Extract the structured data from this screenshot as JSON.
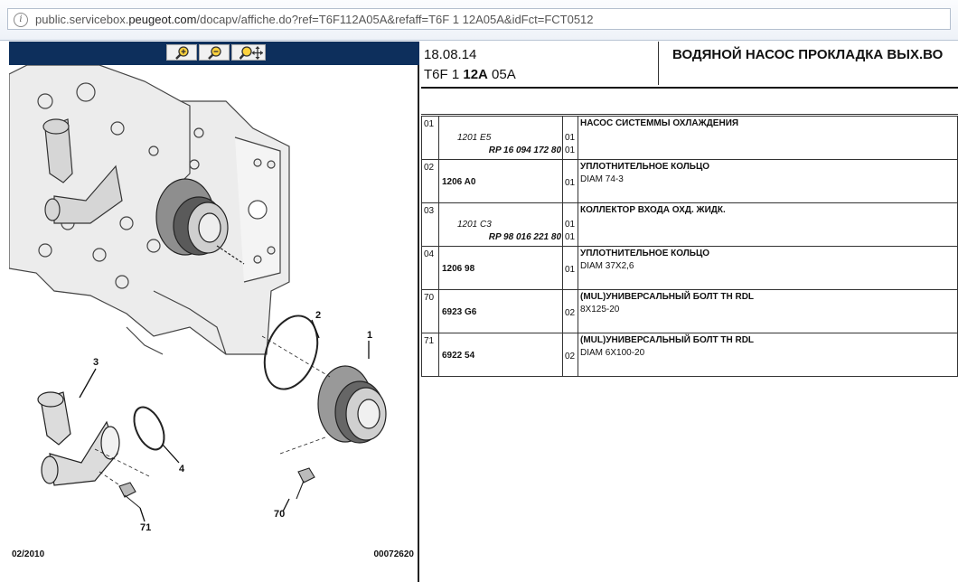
{
  "browser": {
    "url_prefix": "public.servicebox.",
    "url_domain": "peugeot.com",
    "url_suffix": "/docapv/affiche.do?ref=T6F112A05A&refaff=T6F 1 12A05A&idFct=FCT0512"
  },
  "toolbar": {
    "zoom_in_icon": "zoom-in-icon",
    "zoom_out_icon": "zoom-out-icon",
    "zoom_move_icon": "zoom-move-icon"
  },
  "diagram": {
    "callouts": [
      "1",
      "2",
      "3",
      "4",
      "70",
      "71"
    ],
    "footer_date": "02/2010",
    "footer_number": "00072620"
  },
  "header": {
    "date": "18.08.14",
    "code_a": "T6F 1 ",
    "code_b": "12A",
    "code_c": " 05A",
    "title": "ВОДЯНОЙ НАСОС ПРОКЛАДКА ВЫХ.ВО"
  },
  "parts": [
    {
      "idx": "01",
      "ref_italic": "1201 E5",
      "ref_rp": "RP 16 094 172 80",
      "ref_bold": "",
      "qty1": "01",
      "qty2": "01",
      "name": "НАСОС СИСТЕММЫ ОХЛАЖДЕНИЯ",
      "spec": ""
    },
    {
      "idx": "02",
      "ref_italic": "",
      "ref_rp": "",
      "ref_bold": "1206 A0",
      "qty1": "01",
      "qty2": "",
      "name": "УПЛОТНИТЕЛЬНОЕ КОЛЬЦО",
      "spec": "DIAM 74-3"
    },
    {
      "idx": "03",
      "ref_italic": "1201 C3",
      "ref_rp": "RP 98 016 221 80",
      "ref_bold": "",
      "qty1": "01",
      "qty2": "01",
      "name": "КОЛЛЕКТОР ВХОДА ОХД. ЖИДК.",
      "spec": ""
    },
    {
      "idx": "04",
      "ref_italic": "",
      "ref_rp": "",
      "ref_bold": "1206 98",
      "qty1": "01",
      "qty2": "",
      "name": "УПЛОТНИТЕЛЬНОЕ КОЛЬЦО",
      "spec": "DIAM 37X2,6"
    },
    {
      "idx": "70",
      "ref_italic": "",
      "ref_rp": "",
      "ref_bold": "6923 G6",
      "qty1": "02",
      "qty2": "",
      "name": "(MUL)УНИВЕРСАЛЬНЫЙ БОЛТ TH RDL",
      "spec": "8X125-20"
    },
    {
      "idx": "71",
      "ref_italic": "",
      "ref_rp": "",
      "ref_bold": "6922 54",
      "qty1": "02",
      "qty2": "",
      "name": "(MUL)УНИВЕРСАЛЬНЫЙ БОЛТ TH RDL",
      "spec": "DIAM 6X100-20"
    }
  ]
}
